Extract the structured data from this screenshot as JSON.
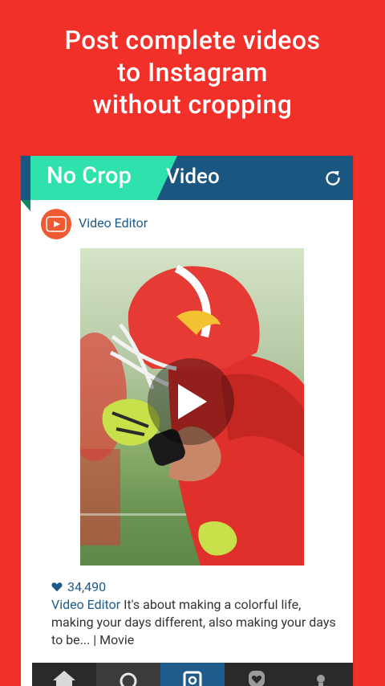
{
  "headline": {
    "line1": "Post complete videos",
    "line2": "to Instagram",
    "line3": "without cropping"
  },
  "topbar": {
    "tag": "No Crop",
    "title": "Video"
  },
  "post": {
    "author": "Video Editor",
    "likes": "34,490",
    "caption_author": "Video Editor",
    "caption_text": "It's about making a colorful life, making your days different, also making your days to be... | Movie"
  },
  "colors": {
    "background": "#f2302a",
    "topbar": "#1b5680",
    "tag": "#2ee1ad",
    "link": "#1d5a8a"
  },
  "icons": [
    "refresh-icon",
    "play-icon",
    "heart-icon",
    "home-icon",
    "search-icon",
    "camera-icon",
    "heart-bubble-icon",
    "profile-icon"
  ]
}
